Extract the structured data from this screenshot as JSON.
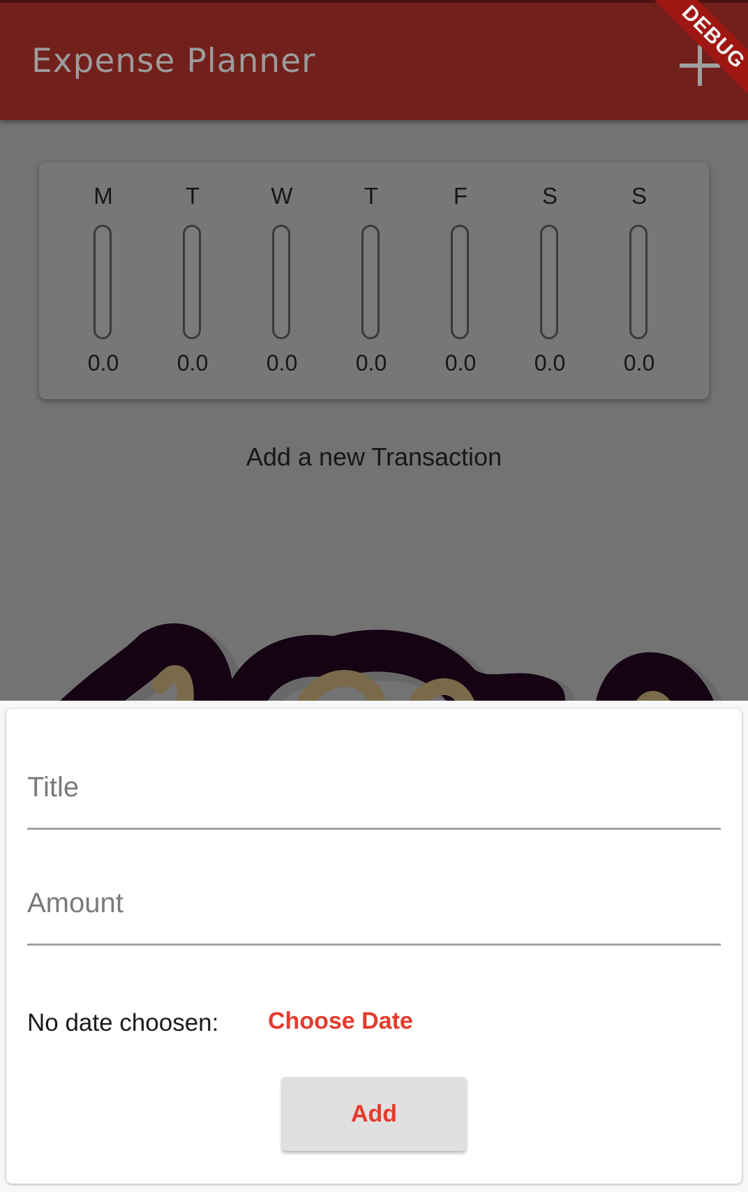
{
  "appbar": {
    "title": "Expense Planner",
    "add_icon": "plus-icon",
    "color": "#72201b"
  },
  "debug_banner": "DEBUG",
  "chart": {
    "days": [
      {
        "day": "M",
        "amount": "0.0",
        "fill": 0
      },
      {
        "day": "T",
        "amount": "0.0",
        "fill": 0
      },
      {
        "day": "W",
        "amount": "0.0",
        "fill": 0
      },
      {
        "day": "T",
        "amount": "0.0",
        "fill": 0
      },
      {
        "day": "F",
        "amount": "0.0",
        "fill": 0
      },
      {
        "day": "S",
        "amount": "0.0",
        "fill": 0
      },
      {
        "day": "S",
        "amount": "0.0",
        "fill": 0
      }
    ]
  },
  "empty_state": {
    "message": "Add a new Transaction"
  },
  "form": {
    "title_placeholder": "Title",
    "title_value": "",
    "amount_placeholder": "Amount",
    "amount_value": "",
    "date_label": "No date choosen:",
    "choose_date_label": "Choose Date",
    "submit_label": "Add",
    "accent_color": "#e53b2c"
  }
}
